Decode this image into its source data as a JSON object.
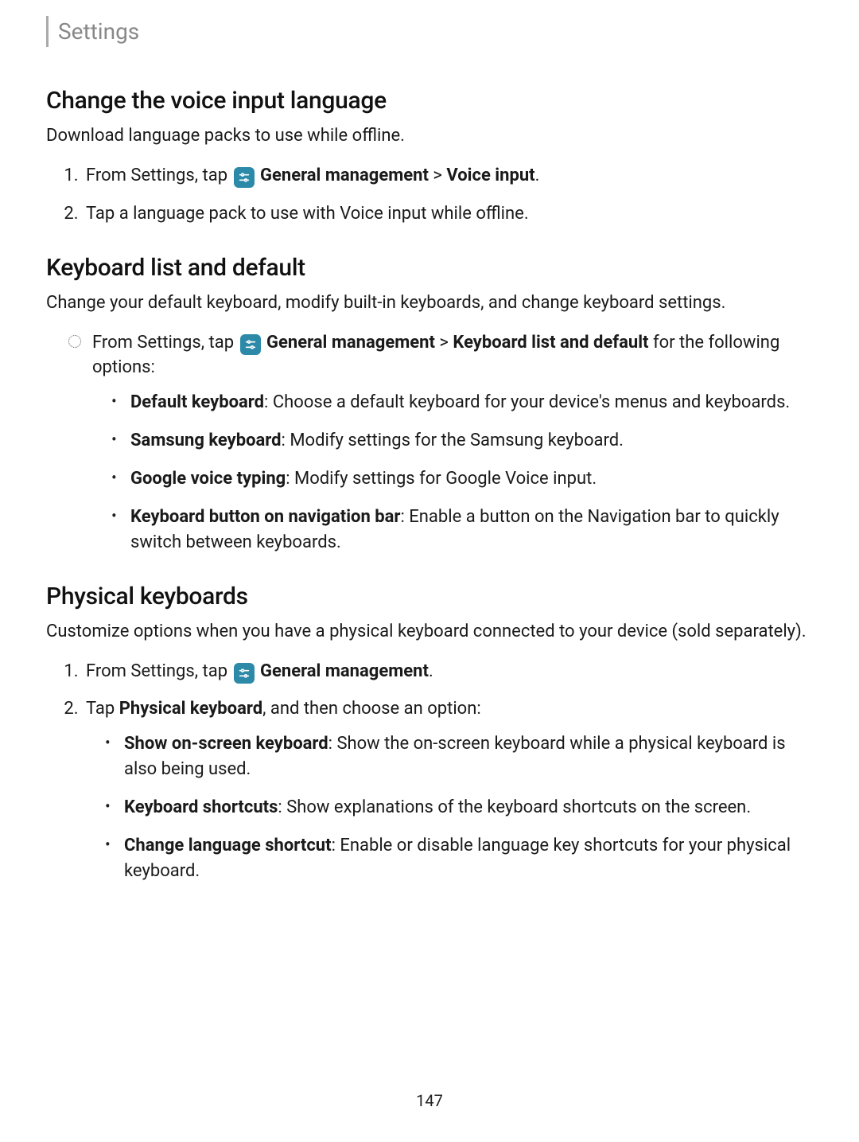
{
  "header": "Settings",
  "pageNumber": "147",
  "sections": {
    "voice": {
      "heading": "Change the voice input language",
      "intro": "Download language packs to use while offline.",
      "steps": {
        "s1_prefix": "From Settings, tap ",
        "s1_gm": "General management",
        "s1_sep": " > ",
        "s1_path2": "Voice input",
        "s1_period": ".",
        "s2": "Tap a language pack to use with Voice input while offline."
      }
    },
    "kblist": {
      "heading": "Keyboard list and default",
      "intro": "Change your default keyboard, modify built-in keyboards, and change keyboard settings.",
      "lead_prefix": "From Settings, tap ",
      "lead_gm": "General management",
      "lead_sep": " > ",
      "lead_path2": "Keyboard list and default",
      "lead_suffix": " for the following options:",
      "items": {
        "i1_label": "Default keyboard",
        "i1_text": ": Choose a default keyboard for your device's menus and keyboards.",
        "i2_label": "Samsung keyboard",
        "i2_text": ": Modify settings for the Samsung keyboard.",
        "i3_label": "Google voice typing",
        "i3_text": ": Modify settings for Google Voice input.",
        "i4_label": "Keyboard button on navigation bar",
        "i4_text": ": Enable a button on the Navigation bar to quickly switch between keyboards."
      }
    },
    "phys": {
      "heading": "Physical keyboards",
      "intro": "Customize options when you have a physical keyboard connected to your device (sold separately).",
      "steps": {
        "s1_prefix": "From Settings, tap ",
        "s1_gm": "General management",
        "s1_period": ".",
        "s2_prefix": "Tap ",
        "s2_bold": "Physical keyboard",
        "s2_suffix": ", and then choose an option:"
      },
      "items": {
        "i1_label": "Show on-screen keyboard",
        "i1_text": ": Show the on-screen keyboard while a physical keyboard is also being used.",
        "i2_label": "Keyboard shortcuts",
        "i2_text": ": Show explanations of the keyboard shortcuts on the screen.",
        "i3_label": "Change language shortcut",
        "i3_text": ": Enable or disable language key shortcuts for your physical keyboard."
      }
    }
  }
}
